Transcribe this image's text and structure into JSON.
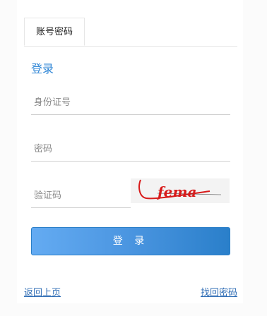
{
  "tabs": [
    {
      "label": "账号密码"
    }
  ],
  "form": {
    "title": "登录",
    "id_placeholder": "身份证号",
    "password_placeholder": "密码",
    "captcha_placeholder": "验证码",
    "captcha_text": "fema",
    "login_label": "登 录"
  },
  "links": {
    "back": "返回上页",
    "recover": "找回密码"
  },
  "colors": {
    "accent": "#2f86d6",
    "button_start": "#64abf2",
    "button_end": "#2a7fca",
    "captcha_ink": "#d81b1b"
  }
}
